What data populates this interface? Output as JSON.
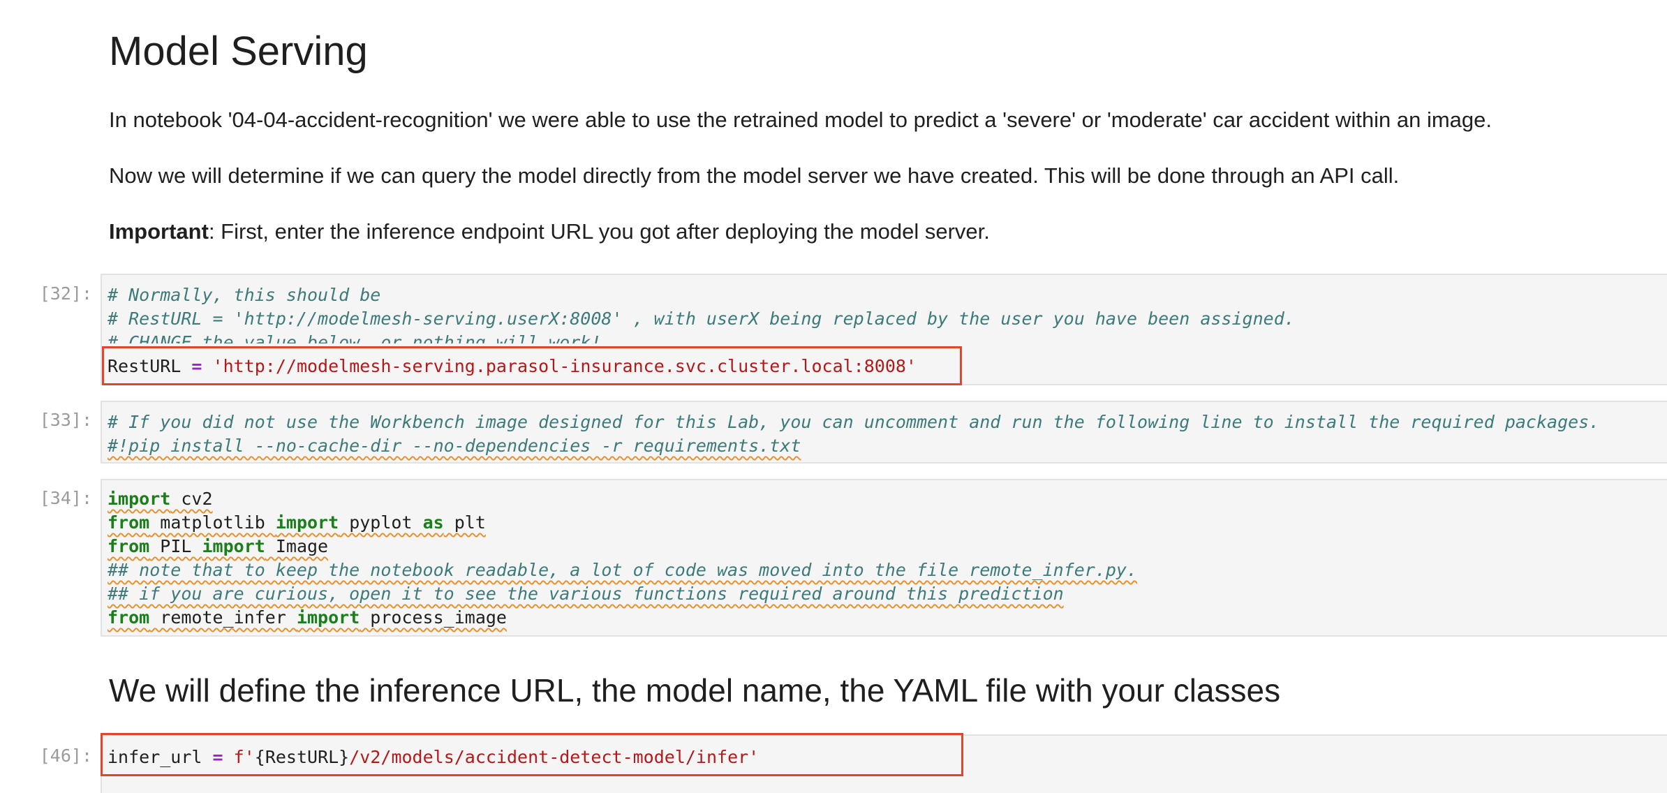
{
  "markdown": {
    "title": "Model Serving",
    "paragraph1": "In notebook '04-04-accident-recognition' we were able to use the retrained model to predict a 'severe' or 'moderate' car accident within an image.",
    "paragraph2": "Now we will determine if we can query the model directly from the model server we have created. This will be done through an API call.",
    "paragraph3_bold": "Important",
    "paragraph3_rest": ": First, enter the inference endpoint URL you got after deploying the model server.",
    "subheading": "We will define the inference URL, the model name, the YAML file with your classes"
  },
  "cells": [
    {
      "prompt": "[32]:",
      "lines": [
        "# Normally, this should be",
        "# RestURL = 'http://modelmesh-serving.userX:8008' , with userX being replaced by the user you have been assigned.",
        "# CHANGE the value below, or nothing will work!"
      ],
      "var": "RestURL",
      "op": "=",
      "str": "'http://modelmesh-serving.parasol-insurance.svc.cluster.local:8008'"
    },
    {
      "prompt": "[33]:",
      "lines": [
        "# If you did not use the Workbench image designed for this Lab, you can uncomment and run the following line to install the required packages.",
        "#!pip install --no-cache-dir --no-dependencies -r requirements.txt"
      ]
    },
    {
      "prompt": "[34]:",
      "lines": [
        {
          "kw1": "import",
          "rest1": " cv2"
        },
        {
          "kw1": "from",
          "rest1": " matplotlib ",
          "kw2": "import",
          "rest2": " pyplot ",
          "kw3": "as",
          "rest3": " plt"
        },
        {
          "kw1": "from",
          "rest1": " PIL ",
          "kw2": "import",
          "rest2": " Image"
        },
        {
          "comment": "## note that to keep the notebook readable, a lot of code was moved into the file remote_infer.py."
        },
        {
          "comment": "## if you are curious, open it to see the various functions required around this prediction"
        },
        {
          "kw1": "from",
          "rest1": " remote_infer ",
          "kw2": "import",
          "rest2": " process_image"
        }
      ]
    },
    {
      "prompt": "[46]:",
      "var": "infer_url",
      "op": "=",
      "fstr_prefix": "f'",
      "fstr_expr": "{RestURL}",
      "fstr_rest": "/v2/models/accident-detect-model/infer'"
    }
  ],
  "colors": {
    "comment": "#3d7a7a",
    "keyword": "#1a7f1a",
    "operator": "#a020c8",
    "string": "#b3191a",
    "highlight": "#e0462e",
    "squiggle": "#e8912f"
  }
}
